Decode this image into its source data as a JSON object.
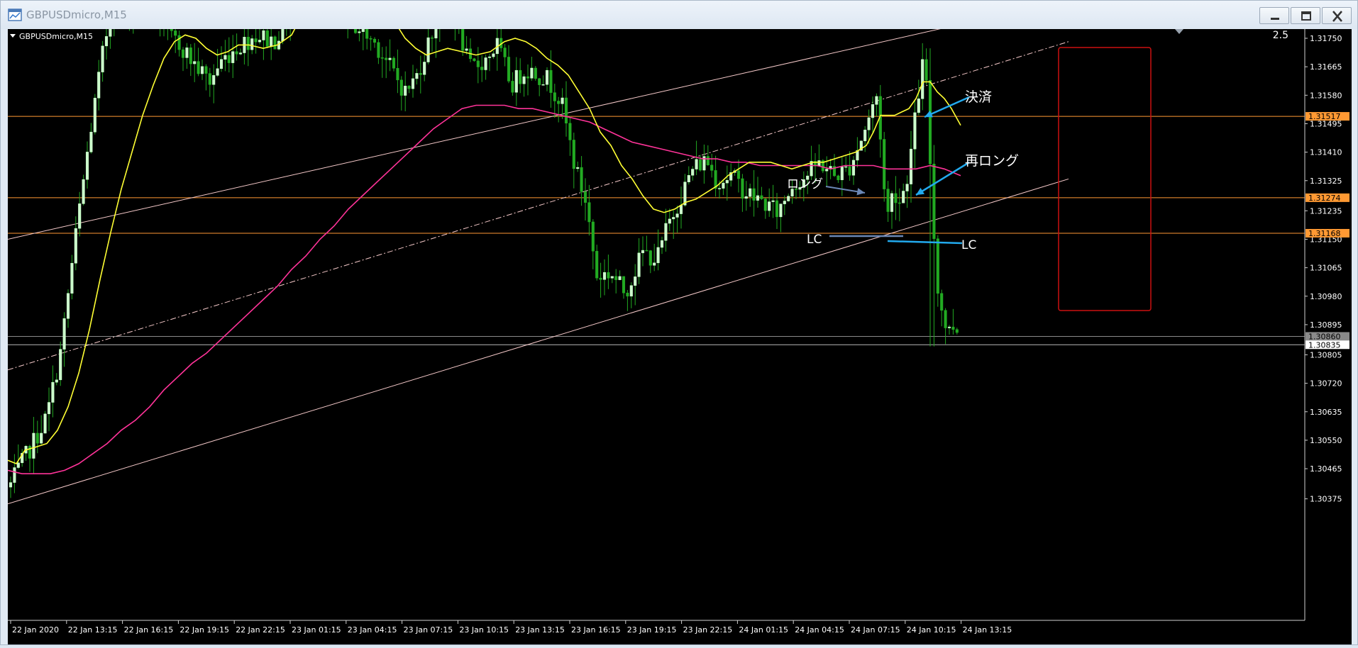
{
  "window": {
    "title": "GBPUSDmicro,M15"
  },
  "chart_header": {
    "symbol_label": "GBPUSDmicro,M15",
    "corner_value": "2.5"
  },
  "colors": {
    "background": "#000000",
    "bull": "#ccffcc",
    "bear": "#22aa22",
    "ma_fast": "#ffff33",
    "ma_slow": "#ff3399",
    "hline": "#ff9933",
    "channel": "#f5c9c9",
    "arrow": "#22aaee",
    "highlight_box": "#cc1111"
  },
  "chart_data": {
    "type": "candlestick",
    "symbol": "GBPUSDmicro",
    "timeframe": "M15",
    "y_ticks": [
      "1.31750",
      "1.31665",
      "1.31580",
      "1.31495",
      "1.31410",
      "1.31325",
      "1.31235",
      "1.31150",
      "1.31065",
      "1.30980",
      "1.30895",
      "1.30805",
      "1.30720",
      "1.30635",
      "1.30550",
      "1.30465",
      "1.30375"
    ],
    "x_ticks": [
      "22 Jan 2020",
      "22 Jan 13:15",
      "22 Jan 16:15",
      "22 Jan 19:15",
      "22 Jan 22:15",
      "23 Jan 01:15",
      "23 Jan 04:15",
      "23 Jan 07:15",
      "23 Jan 10:15",
      "23 Jan 13:15",
      "23 Jan 16:15",
      "23 Jan 19:15",
      "23 Jan 22:15",
      "24 Jan 01:15",
      "24 Jan 04:15",
      "24 Jan 07:15",
      "24 Jan 10:15",
      "24 Jan 13:15"
    ],
    "price_labels": [
      {
        "value": "1.31517",
        "price": 1.31517,
        "style": "orange"
      },
      {
        "value": "1.31274",
        "price": 1.31274,
        "style": "orange"
      },
      {
        "value": "1.31168",
        "price": 1.31168,
        "style": "orange"
      },
      {
        "value": "1.30860",
        "price": 1.3086,
        "style": "gray"
      },
      {
        "value": "1.30835",
        "price": 1.30835,
        "style": "white"
      }
    ],
    "horizontal_lines": [
      1.31517,
      1.31274,
      1.31168,
      1.3086,
      1.30835
    ],
    "channel_lines": [
      {
        "style": "solid",
        "from": {
          "x": 0,
          "price": 1.3115
        },
        "to": {
          "x": 1506,
          "price": 1.3187
        }
      },
      {
        "style": "dashdot",
        "from": {
          "x": 0,
          "price": 1.3076
        },
        "to": {
          "x": 1495,
          "price": 1.3174
        }
      },
      {
        "style": "solid",
        "from": {
          "x": 0,
          "price": 1.3036
        },
        "to": {
          "x": 1495,
          "price": 1.3133
        }
      }
    ],
    "ma_fast": [
      [
        0,
        1.3049
      ],
      [
        12,
        1.3048
      ],
      [
        24,
        1.3052
      ],
      [
        40,
        1.3053
      ],
      [
        55,
        1.3054
      ],
      [
        70,
        1.3058
      ],
      [
        85,
        1.3065
      ],
      [
        100,
        1.3075
      ],
      [
        115,
        1.3088
      ],
      [
        130,
        1.3103
      ],
      [
        145,
        1.3117
      ],
      [
        160,
        1.313
      ],
      [
        175,
        1.3141
      ],
      [
        190,
        1.3152
      ],
      [
        205,
        1.3161
      ],
      [
        220,
        1.3169
      ],
      [
        235,
        1.3174
      ],
      [
        250,
        1.3176
      ],
      [
        265,
        1.3175
      ],
      [
        280,
        1.3172
      ],
      [
        295,
        1.317
      ],
      [
        310,
        1.3171
      ],
      [
        325,
        1.3173
      ],
      [
        340,
        1.3173
      ],
      [
        360,
        1.3172
      ],
      [
        380,
        1.3173
      ],
      [
        400,
        1.3176
      ],
      [
        415,
        1.3182
      ],
      [
        425,
        1.3186
      ],
      [
        440,
        1.3188
      ],
      [
        455,
        1.3187
      ],
      [
        470,
        1.3186
      ],
      [
        485,
        1.3186
      ],
      [
        500,
        1.3186
      ],
      [
        515,
        1.3186
      ],
      [
        530,
        1.3184
      ],
      [
        545,
        1.318
      ],
      [
        560,
        1.3175
      ],
      [
        575,
        1.3172
      ],
      [
        590,
        1.317
      ],
      [
        605,
        1.3171
      ],
      [
        620,
        1.3172
      ],
      [
        640,
        1.3171
      ],
      [
        660,
        1.317
      ],
      [
        680,
        1.3171
      ],
      [
        700,
        1.3174
      ],
      [
        715,
        1.3175
      ],
      [
        730,
        1.3174
      ],
      [
        745,
        1.3172
      ],
      [
        760,
        1.3169
      ],
      [
        775,
        1.3167
      ],
      [
        790,
        1.3164
      ],
      [
        805,
        1.3159
      ],
      [
        820,
        1.3154
      ],
      [
        835,
        1.3147
      ],
      [
        850,
        1.3143
      ],
      [
        865,
        1.3137
      ],
      [
        880,
        1.3133
      ],
      [
        895,
        1.3128
      ],
      [
        910,
        1.3124
      ],
      [
        925,
        1.3123
      ],
      [
        940,
        1.3124
      ],
      [
        955,
        1.3126
      ],
      [
        970,
        1.3127
      ],
      [
        985,
        1.3129
      ],
      [
        1000,
        1.3131
      ],
      [
        1015,
        1.3134
      ],
      [
        1030,
        1.3136
      ],
      [
        1045,
        1.3138
      ],
      [
        1060,
        1.3138
      ],
      [
        1075,
        1.3138
      ],
      [
        1090,
        1.3137
      ],
      [
        1105,
        1.3136
      ],
      [
        1120,
        1.3137
      ],
      [
        1135,
        1.3138
      ],
      [
        1150,
        1.3138
      ],
      [
        1165,
        1.3139
      ],
      [
        1180,
        1.314
      ],
      [
        1195,
        1.3141
      ],
      [
        1210,
        1.3143
      ],
      [
        1220,
        1.3147
      ],
      [
        1230,
        1.3152
      ],
      [
        1240,
        1.3152
      ],
      [
        1250,
        1.3152
      ],
      [
        1260,
        1.3153
      ],
      [
        1270,
        1.3154
      ],
      [
        1280,
        1.3157
      ],
      [
        1290,
        1.3162
      ],
      [
        1300,
        1.3162
      ],
      [
        1310,
        1.3159
      ],
      [
        1320,
        1.3157
      ],
      [
        1330,
        1.3154
      ],
      [
        1343,
        1.3149
      ]
    ],
    "ma_slow": [
      [
        0,
        1.3046
      ],
      [
        20,
        1.3045
      ],
      [
        40,
        1.3045
      ],
      [
        60,
        1.3045
      ],
      [
        80,
        1.3046
      ],
      [
        100,
        1.3048
      ],
      [
        120,
        1.3051
      ],
      [
        140,
        1.3054
      ],
      [
        160,
        1.3058
      ],
      [
        180,
        1.3061
      ],
      [
        200,
        1.3065
      ],
      [
        220,
        1.307
      ],
      [
        240,
        1.3074
      ],
      [
        260,
        1.3078
      ],
      [
        280,
        1.3081
      ],
      [
        300,
        1.3085
      ],
      [
        320,
        1.3089
      ],
      [
        340,
        1.3093
      ],
      [
        360,
        1.3097
      ],
      [
        380,
        1.3101
      ],
      [
        400,
        1.3106
      ],
      [
        420,
        1.311
      ],
      [
        440,
        1.3115
      ],
      [
        460,
        1.3119
      ],
      [
        480,
        1.3124
      ],
      [
        500,
        1.3128
      ],
      [
        520,
        1.3132
      ],
      [
        540,
        1.3136
      ],
      [
        560,
        1.314
      ],
      [
        580,
        1.3144
      ],
      [
        600,
        1.3148
      ],
      [
        620,
        1.3151
      ],
      [
        640,
        1.3154
      ],
      [
        660,
        1.3155
      ],
      [
        680,
        1.3155
      ],
      [
        700,
        1.3155
      ],
      [
        720,
        1.3154
      ],
      [
        740,
        1.3154
      ],
      [
        760,
        1.3153
      ],
      [
        780,
        1.3152
      ],
      [
        800,
        1.3151
      ],
      [
        820,
        1.315
      ],
      [
        840,
        1.3148
      ],
      [
        860,
        1.3146
      ],
      [
        880,
        1.3144
      ],
      [
        900,
        1.3143
      ],
      [
        920,
        1.3142
      ],
      [
        940,
        1.3141
      ],
      [
        960,
        1.314
      ],
      [
        980,
        1.3139
      ],
      [
        1000,
        1.3139
      ],
      [
        1020,
        1.3138
      ],
      [
        1040,
        1.3138
      ],
      [
        1060,
        1.3137
      ],
      [
        1080,
        1.3137
      ],
      [
        1100,
        1.3137
      ],
      [
        1120,
        1.3137
      ],
      [
        1140,
        1.3137
      ],
      [
        1160,
        1.3136
      ],
      [
        1180,
        1.3137
      ],
      [
        1200,
        1.3137
      ],
      [
        1220,
        1.3137
      ],
      [
        1240,
        1.3136
      ],
      [
        1260,
        1.3136
      ],
      [
        1280,
        1.3136
      ],
      [
        1300,
        1.3137
      ],
      [
        1320,
        1.3136
      ],
      [
        1343,
        1.3134
      ]
    ]
  },
  "annotations": {
    "kessai": "決済",
    "sai_long": "再ロング",
    "long": "ロング",
    "lc_left": "LC",
    "lc_right": "LC"
  }
}
